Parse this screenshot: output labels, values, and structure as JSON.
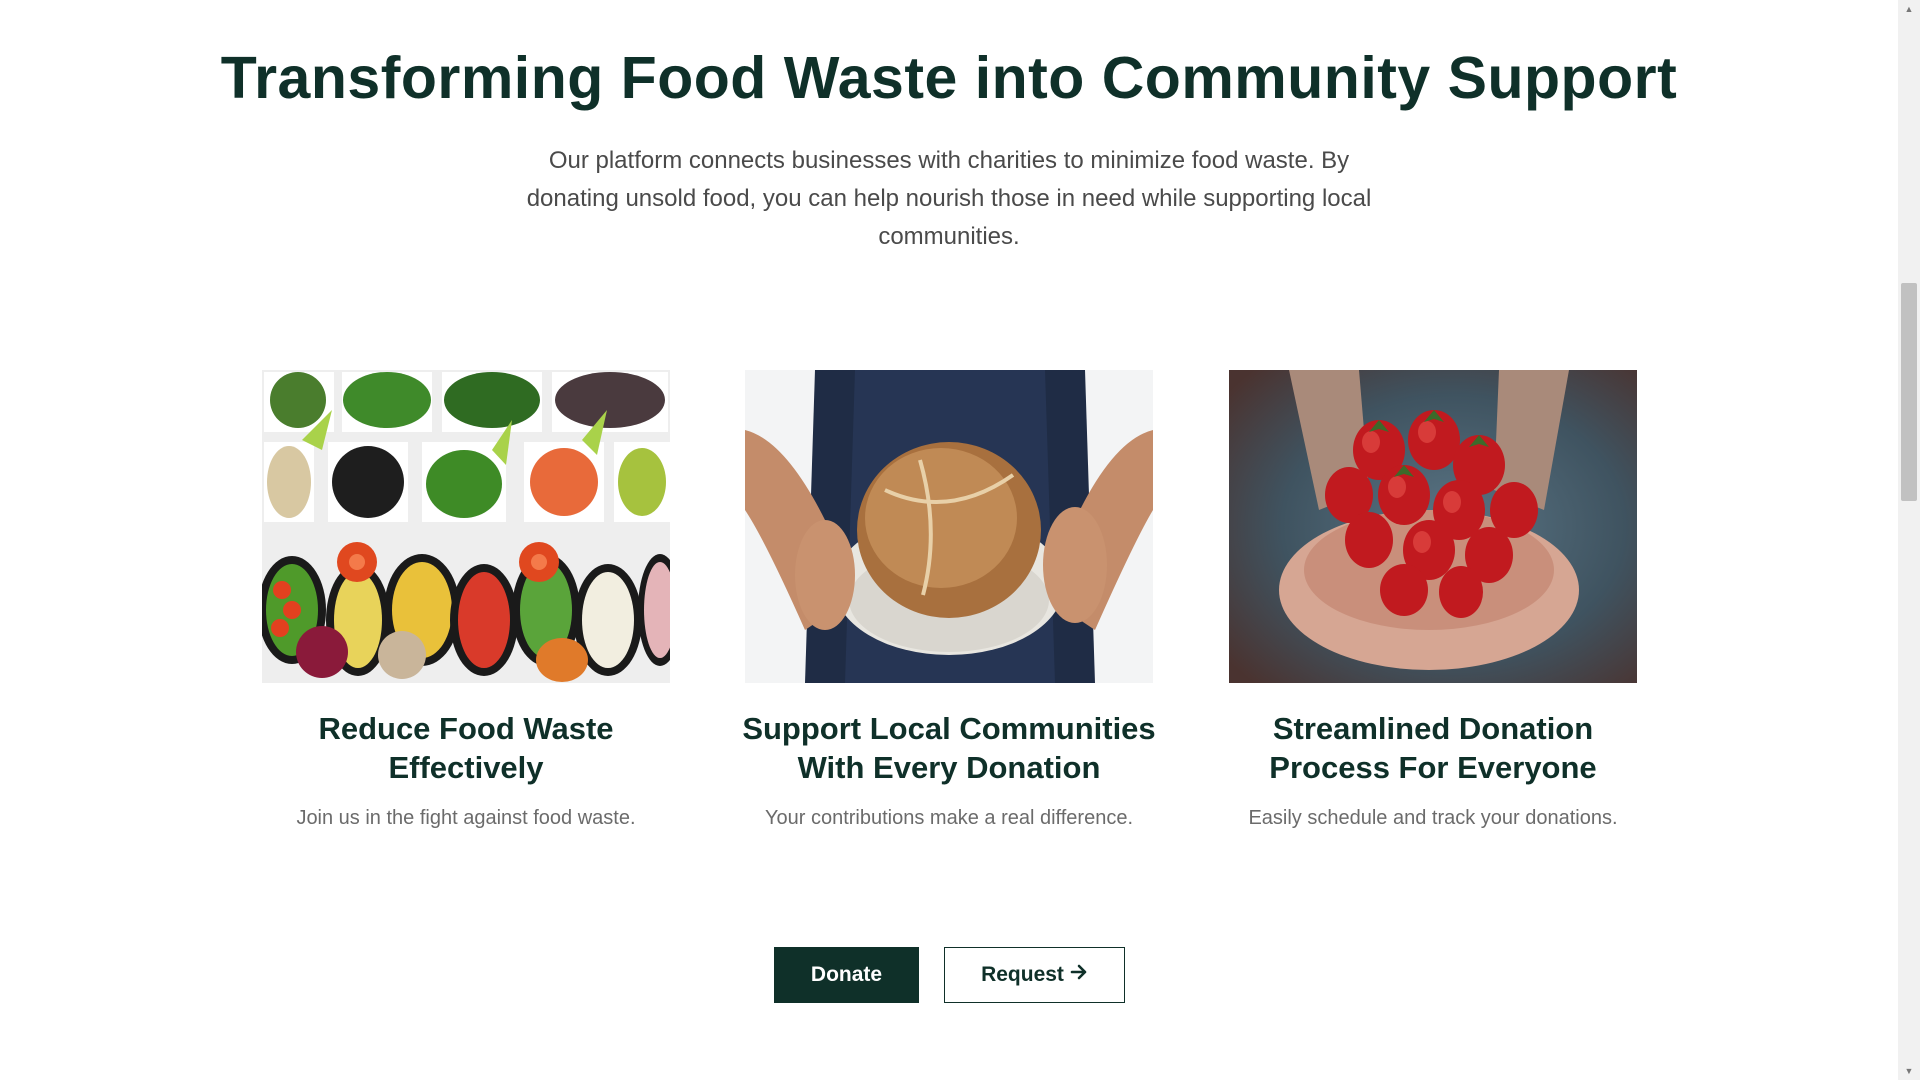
{
  "hero": {
    "title": "Transforming Food Waste into Community Support",
    "description": "Our platform connects businesses with charities to minimize food waste. By donating unsold food, you can help nourish those in need while supporting local communities."
  },
  "features": [
    {
      "title": "Reduce Food Waste Effectively",
      "text": "Join us in the fight against food waste.",
      "image": "vegetable-buffet-image"
    },
    {
      "title": "Support Local Communities With Every Donation",
      "text": "Your contributions make a real difference.",
      "image": "bread-in-hands-image"
    },
    {
      "title": "Streamlined Donation Process For Everyone",
      "text": "Easily schedule and track your donations.",
      "image": "strawberries-in-hands-image"
    }
  ],
  "actions": {
    "donate_label": "Donate",
    "request_label": "Request",
    "request_icon": "arrow-right-icon"
  },
  "colors": {
    "primary": "#0f3029",
    "text_muted": "#6b6b6b",
    "background": "#ffffff"
  }
}
